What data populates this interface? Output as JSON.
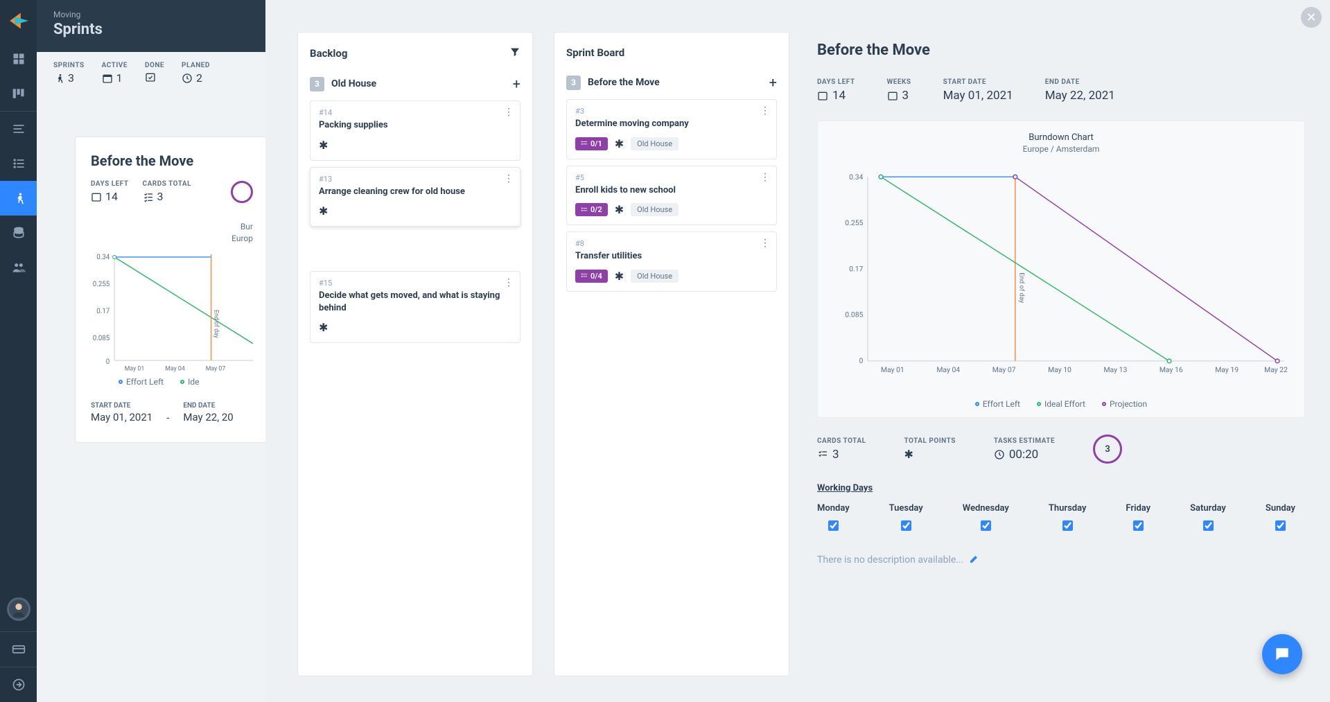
{
  "project_name": "Moving",
  "page_title": "Sprints",
  "left_stats": {
    "sprints": {
      "label": "SPRINTS",
      "value": "3"
    },
    "active": {
      "label": "ACTIVE",
      "value": "1"
    },
    "done": {
      "label": "DONE",
      "value": ""
    },
    "planned": {
      "label": "PLANED",
      "value": "2"
    }
  },
  "mini_card": {
    "title": "Before the Move",
    "days_left": {
      "label": "DAYS LEFT",
      "value": "14"
    },
    "cards_total": {
      "label": "CARDS TOTAL",
      "value": "3"
    },
    "chart_title_cut1": "Bur",
    "chart_title_cut2": "Europ",
    "y_ticks": [
      "0.34",
      "0.255",
      "0.17",
      "0.085",
      "0"
    ],
    "x_ticks": [
      "May 01",
      "May 04",
      "May 07"
    ],
    "eod": "End of day",
    "legend": [
      "Effort Left",
      "Ide"
    ],
    "start": {
      "label": "START DATE",
      "value": "May 01, 2021"
    },
    "end": {
      "label": "END DATE",
      "value": "May 22, 20"
    },
    "dash": "-"
  },
  "backlog": {
    "title": "Backlog",
    "group": {
      "count": "3",
      "name": "Old House"
    },
    "cards": [
      {
        "id": "#14",
        "title": "Packing supplies"
      },
      {
        "id": "#13",
        "title": "Arrange cleaning crew for old house",
        "highlight": true
      },
      {
        "id": "#15",
        "title": "Decide what gets moved, and what is staying behind",
        "extra_margin": true
      }
    ]
  },
  "board": {
    "title": "Sprint Board",
    "group": {
      "count": "3",
      "name": "Before the Move"
    },
    "cards": [
      {
        "id": "#3",
        "title": "Determine moving company",
        "tasks": "0/1",
        "tag": "Old House"
      },
      {
        "id": "#5",
        "title": "Enroll kids to new school",
        "tasks": "0/2",
        "tag": "Old House"
      },
      {
        "id": "#8",
        "title": "Transfer utilities",
        "tasks": "0/4",
        "tag": "Old House"
      }
    ]
  },
  "detail": {
    "title": "Before the Move",
    "days_left": {
      "label": "DAYS LEFT",
      "value": "14"
    },
    "weeks": {
      "label": "WEEKS",
      "value": "3"
    },
    "start": {
      "label": "START DATE",
      "value": "May 01, 2021"
    },
    "end": {
      "label": "END DATE",
      "value": "May 22, 2021"
    },
    "chart_title": "Burndown Chart",
    "chart_sub": "Europe / Amsterdam",
    "legend": {
      "effort": "Effort Left",
      "ideal": "Ideal Effort",
      "proj": "Projection"
    },
    "cards_total": {
      "label": "CARDS TOTAL",
      "value": "3"
    },
    "total_points": {
      "label": "TOTAL POINTS"
    },
    "tasks_est": {
      "label": "TASKS ESTIMATE",
      "value": "00:20"
    },
    "ring": "3",
    "working_days_title": "Working Days",
    "days": [
      "Monday",
      "Tuesday",
      "Wednesday",
      "Thursday",
      "Friday",
      "Saturday",
      "Sunday"
    ],
    "desc": "There is no description available..."
  },
  "chart_data": {
    "type": "line",
    "title": "Burndown Chart",
    "subtitle": "Europe / Amsterdam",
    "xlabel": "",
    "ylabel": "",
    "x_ticks": [
      "May 01",
      "May 04",
      "May 07",
      "May 10",
      "May 13",
      "May 16",
      "May 19",
      "May 22"
    ],
    "y_ticks": [
      0,
      0.085,
      0.17,
      0.255,
      0.34
    ],
    "ylim": [
      0,
      0.34
    ],
    "end_of_day_marker": "May 08",
    "series": [
      {
        "name": "Effort Left",
        "color": "#2f87ff",
        "x": [
          "May 01",
          "May 08"
        ],
        "values": [
          0.34,
          0.34
        ]
      },
      {
        "name": "Ideal Effort",
        "color": "#29b765",
        "x": [
          "May 01",
          "May 16"
        ],
        "values": [
          0.34,
          0
        ]
      },
      {
        "name": "Projection",
        "color": "#8e3fa8",
        "x": [
          "May 08",
          "May 22"
        ],
        "values": [
          0.34,
          0
        ]
      }
    ]
  },
  "colors": {
    "accent": "#2f87ff",
    "purple": "#8e3fa8",
    "green": "#29b765",
    "orange": "#f28c38"
  }
}
